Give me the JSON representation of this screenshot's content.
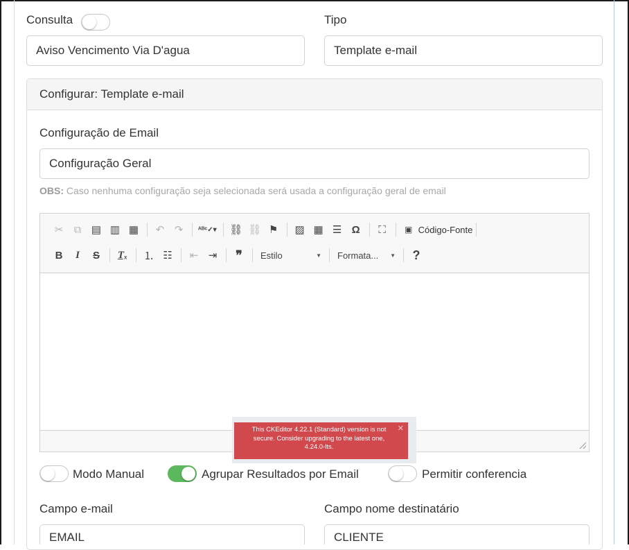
{
  "form": {
    "consulta_label": "Consulta",
    "tipo_label": "Tipo",
    "name_value": "Aviso Vencimento Via D'agua",
    "tipo_value": "Template e-mail"
  },
  "panel": {
    "header": "Configurar: Template e-mail",
    "email_config_label": "Configuração de Email",
    "email_config_value": "Configuração Geral",
    "obs_prefix": "OBS:",
    "obs_text": " Caso nenhuma configuração seja selecionada será usada a configuração geral de email"
  },
  "editor": {
    "source_label": "Código-Fonte",
    "style_combo": "Estilo",
    "format_combo": "Formata...",
    "help": "?",
    "warning": "This CKEditor 4.22.1 (Standard) version is not secure. Consider upgrading to the latest one, 4.24.0-lts.",
    "warning_close": "✕"
  },
  "toggles": {
    "manual_label": "Modo Manual",
    "agrupar_label": "Agrupar Resultados por Email",
    "conferencia_label": "Permitir conferencia"
  },
  "fields": {
    "email_label": "Campo e-mail",
    "email_value": "EMAIL",
    "recipient_label": "Campo nome destinatário",
    "recipient_value": "CLIENTE"
  },
  "colors": {
    "toggle_on": "#5cb85c",
    "warning_bg": "#d1494c"
  }
}
